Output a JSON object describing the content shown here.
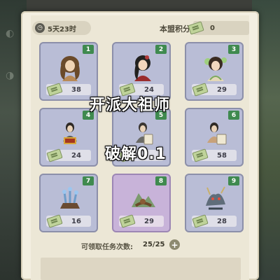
{
  "header": {
    "timer_icon": "clock-icon",
    "timer_text": "5天23时",
    "points_label": "本盟积分:",
    "points_value": "0"
  },
  "cards": [
    {
      "number": "1",
      "cost": "38",
      "figure": "female-disciple-1"
    },
    {
      "number": "2",
      "cost": "24",
      "figure": "female-disciple-2"
    },
    {
      "number": "3",
      "cost": "29",
      "figure": "female-disciple-3"
    },
    {
      "number": "4",
      "cost": "24",
      "figure": "skill-book-figure-1"
    },
    {
      "number": "5",
      "cost": "",
      "figure": "skill-book-figure-2"
    },
    {
      "number": "6",
      "cost": "58",
      "figure": "skill-book-figure-3"
    },
    {
      "number": "7",
      "cost": "16",
      "figure": "crystal-tree-relic"
    },
    {
      "number": "8",
      "cost": "29",
      "figure": "landscape-treasure",
      "selected": true
    },
    {
      "number": "9",
      "cost": "28",
      "figure": "monster-beast"
    }
  ],
  "overlay": {
    "title": "开派大祖师",
    "subtitle": "破解0.1"
  },
  "claims": {
    "label": "可领取任务次数:",
    "value": "25/25",
    "plus_icon": "plus-icon"
  },
  "colors": {
    "card_bg": "#b9bdd6",
    "card_selected_bg": "#c8b3d9",
    "number_badge": "#3f8a4f",
    "panel_bg": "#f3efe1"
  }
}
